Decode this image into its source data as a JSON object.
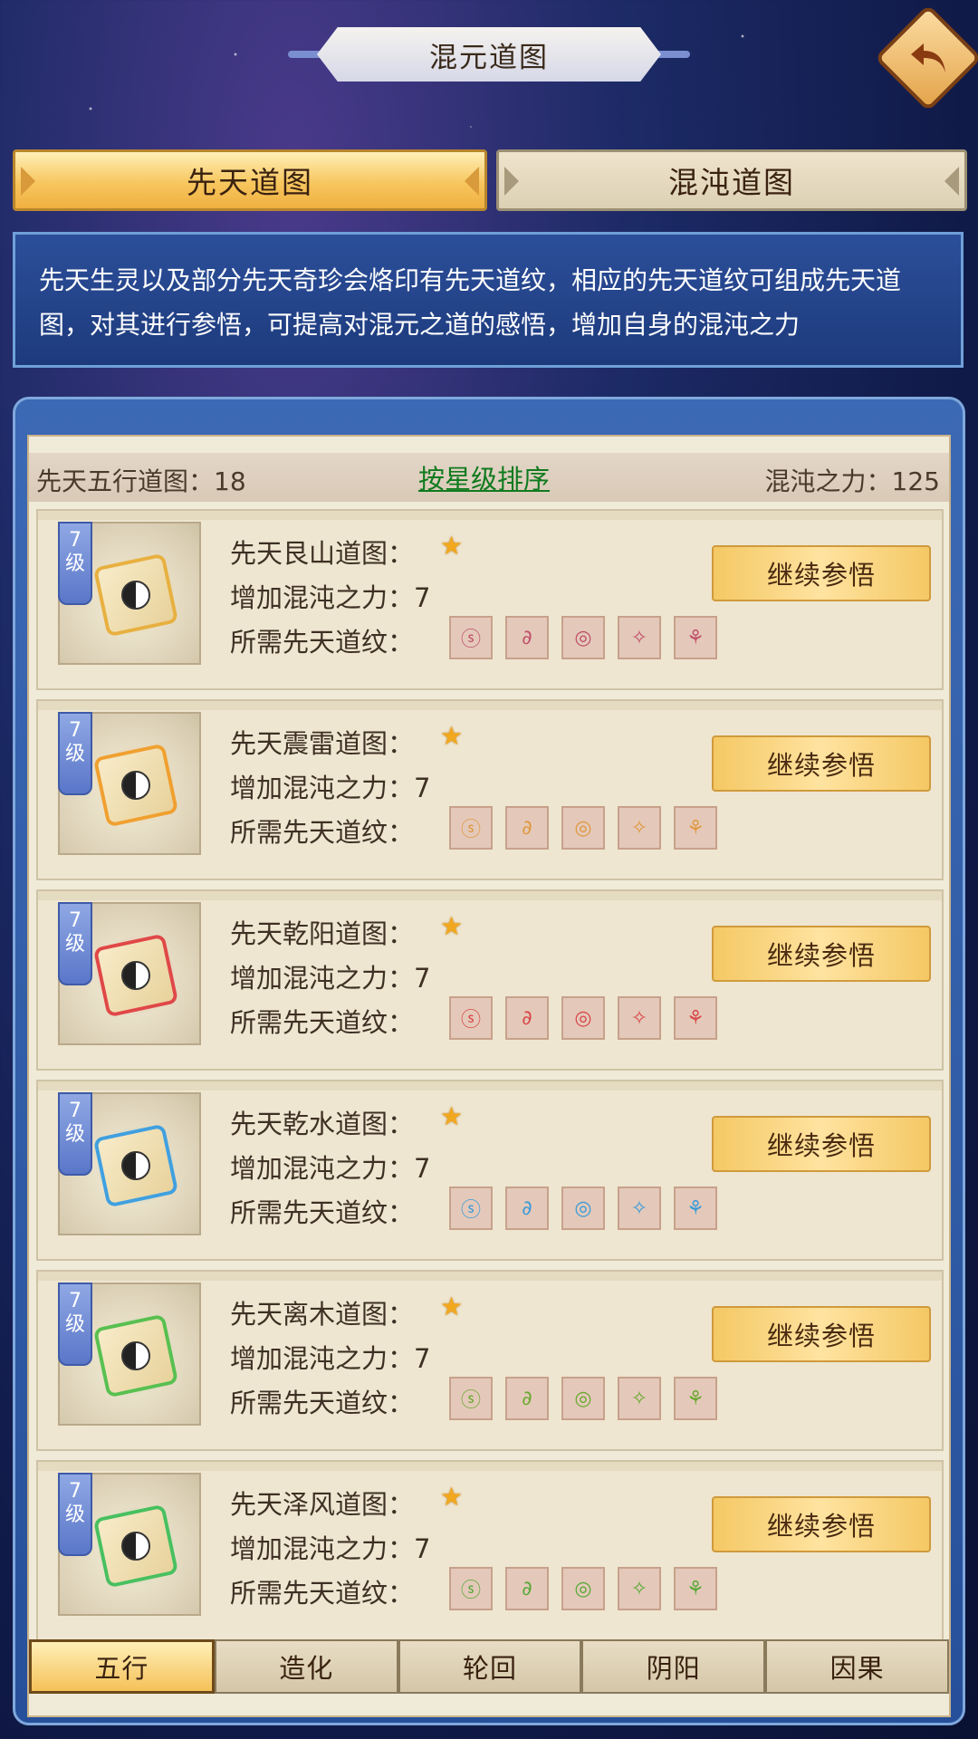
{
  "header": {
    "title": "混元道图"
  },
  "top_tabs": [
    {
      "label": "先天道图",
      "active": true
    },
    {
      "label": "混沌道图",
      "active": false
    }
  ],
  "description": "先天生灵以及部分先天奇珍会烙印有先天道纹，相应的先天道纹可组成先天道图，对其进行参悟，可提高对混元之道的感悟，增加自身的混沌之力",
  "info_bar": {
    "left": "先天五行道图：18",
    "center": "按星级排序",
    "right": "混沌之力：125"
  },
  "labels": {
    "level_num": "7",
    "level_unit": "级",
    "runes_label": "所需先天道纹：",
    "button": "继续参悟"
  },
  "cards": [
    {
      "name": "先天艮山道图：",
      "power": "增加混沌之力：7",
      "stars": 1,
      "color": "#e8b040",
      "rune_color": "#c0506a"
    },
    {
      "name": "先天震雷道图：",
      "power": "增加混沌之力：7",
      "stars": 1,
      "color": "#f0a030",
      "rune_color": "#e09840"
    },
    {
      "name": "先天乾阳道图：",
      "power": "增加混沌之力：7",
      "stars": 1,
      "color": "#e04848",
      "rune_color": "#d84848"
    },
    {
      "name": "先天乾水道图：",
      "power": "增加混沌之力：7",
      "stars": 1,
      "color": "#40a0e0",
      "rune_color": "#3a9ad8"
    },
    {
      "name": "先天离木道图：",
      "power": "增加混沌之力：7",
      "stars": 1,
      "color": "#58c050",
      "rune_color": "#6aa830"
    },
    {
      "name": "先天泽风道图：",
      "power": "增加混沌之力：7",
      "stars": 1,
      "color": "#48c060",
      "rune_color": "#58a838"
    }
  ],
  "bottom_tabs": [
    {
      "label": "五行",
      "active": true
    },
    {
      "label": "造化",
      "active": false
    },
    {
      "label": "轮回",
      "active": false
    },
    {
      "label": "阴阳",
      "active": false
    },
    {
      "label": "因果",
      "active": false
    }
  ]
}
